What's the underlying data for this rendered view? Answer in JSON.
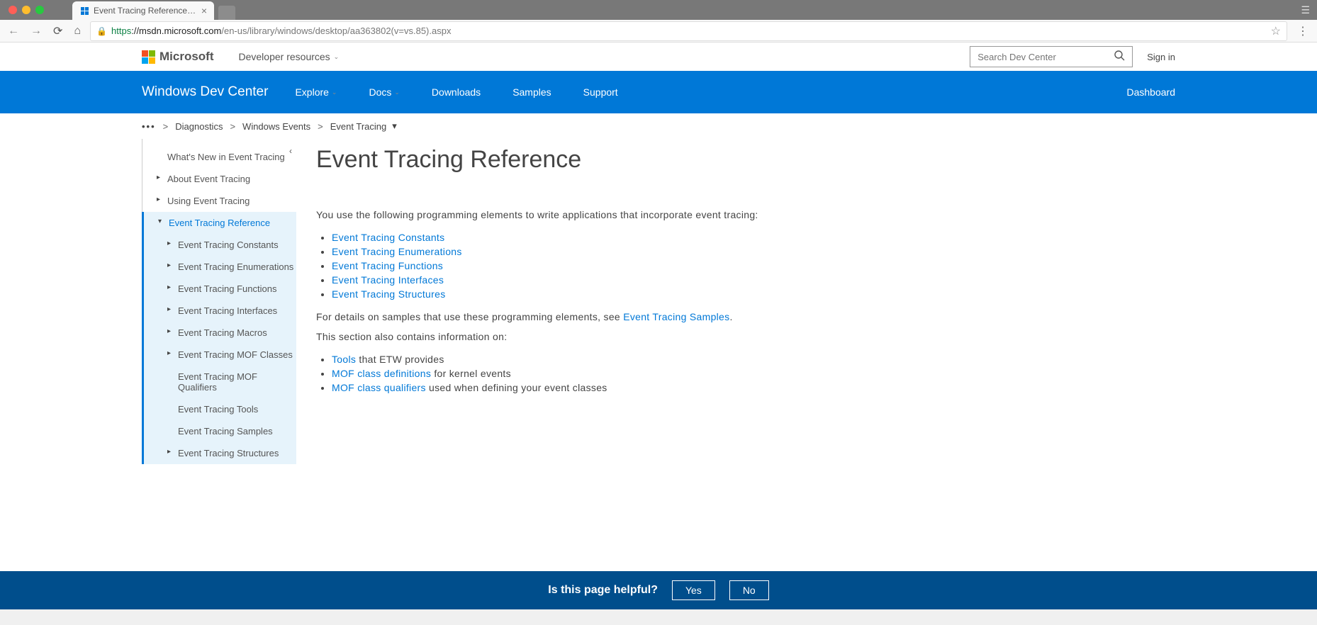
{
  "browser": {
    "tab_title": "Event Tracing Reference (Wind",
    "url_scheme": "https",
    "url_host": "://msdn.microsoft.com",
    "url_path": "/en-us/library/windows/desktop/aa363802(v=vs.85).aspx"
  },
  "ms_header": {
    "brand": "Microsoft",
    "dev_resources": "Developer resources",
    "search_placeholder": "Search Dev Center",
    "sign_in": "Sign in"
  },
  "nav": {
    "title": "Windows Dev Center",
    "links": {
      "explore": "Explore",
      "docs": "Docs",
      "downloads": "Downloads",
      "samples": "Samples",
      "support": "Support"
    },
    "dashboard": "Dashboard"
  },
  "breadcrumb": {
    "diagnostics": "Diagnostics",
    "windows_events": "Windows Events",
    "event_tracing": "Event Tracing"
  },
  "sidebar": {
    "whats_new": "What's New in Event Tracing",
    "about": "About Event Tracing",
    "using": "Using Event Tracing",
    "reference": "Event Tracing Reference",
    "constants": "Event Tracing Constants",
    "enumerations": "Event Tracing Enumerations",
    "functions": "Event Tracing Functions",
    "interfaces": "Event Tracing Interfaces",
    "macros": "Event Tracing Macros",
    "mof_classes": "Event Tracing MOF Classes",
    "mof_qualifiers": "Event Tracing MOF Qualifiers",
    "tools": "Event Tracing Tools",
    "samples": "Event Tracing Samples",
    "structures": "Event Tracing Structures"
  },
  "article": {
    "title": "Event Tracing Reference",
    "intro": "You use the following programming elements to write applications that incorporate event tracing:",
    "links": {
      "constants": "Event Tracing Constants",
      "enumerations": "Event Tracing Enumerations",
      "functions": "Event Tracing Functions",
      "interfaces": "Event Tracing Interfaces",
      "structures": "Event Tracing Structures"
    },
    "samples_prefix": "For details on samples that use these programming elements, see ",
    "samples_link": "Event Tracing Samples",
    "samples_suffix": ".",
    "section_also": "This section also contains information on:",
    "tools_link": "Tools",
    "tools_suffix": " that ETW provides",
    "mof_def_link": "MOF class definitions",
    "mof_def_suffix": " for kernel events",
    "mof_qual_link": "MOF class qualifiers",
    "mof_qual_suffix": " used when defining your event classes"
  },
  "feedback": {
    "question": "Is this page helpful?",
    "yes": "Yes",
    "no": "No"
  }
}
